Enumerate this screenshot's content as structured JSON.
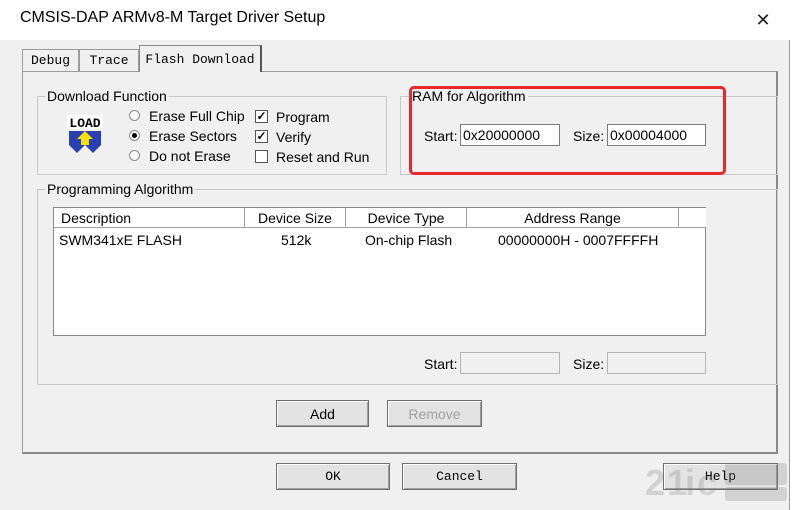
{
  "window": {
    "title": "CMSIS-DAP ARMv8-M Target Driver Setup",
    "close_glyph": "✕"
  },
  "tabs": [
    {
      "label": "Debug"
    },
    {
      "label": "Trace"
    },
    {
      "label": "Flash Download"
    }
  ],
  "download_function": {
    "label": "Download Function",
    "icon_text": "LOAD",
    "options": [
      {
        "label": "Erase Full Chip",
        "selected": false
      },
      {
        "label": "Erase Sectors",
        "selected": true
      },
      {
        "label": "Do not Erase",
        "selected": false
      }
    ],
    "checks": [
      {
        "label": "Program",
        "checked": true
      },
      {
        "label": "Verify",
        "checked": true
      },
      {
        "label": "Reset and Run",
        "checked": false
      }
    ]
  },
  "ram": {
    "label": "RAM for Algorithm",
    "start_label": "Start:",
    "start_value": "0x20000000",
    "size_label": "Size:",
    "size_value": "0x00004000"
  },
  "programming": {
    "label": "Programming Algorithm",
    "columns": [
      "Description",
      "Device Size",
      "Device Type",
      "Address Range"
    ],
    "rows": [
      {
        "description": "SWM341xE FLASH",
        "size": "512k",
        "type": "On-chip Flash",
        "range": "00000000H - 0007FFFFH"
      }
    ],
    "start_label": "Start:",
    "start_value": "",
    "size_label": "Size:",
    "size_value": ""
  },
  "buttons": {
    "add": "Add",
    "remove": "Remove",
    "ok": "OK",
    "cancel": "Cancel",
    "help": "Help"
  },
  "colors": {
    "highlight": "#e8282d",
    "dialog_bg": "#f0f0f0"
  }
}
